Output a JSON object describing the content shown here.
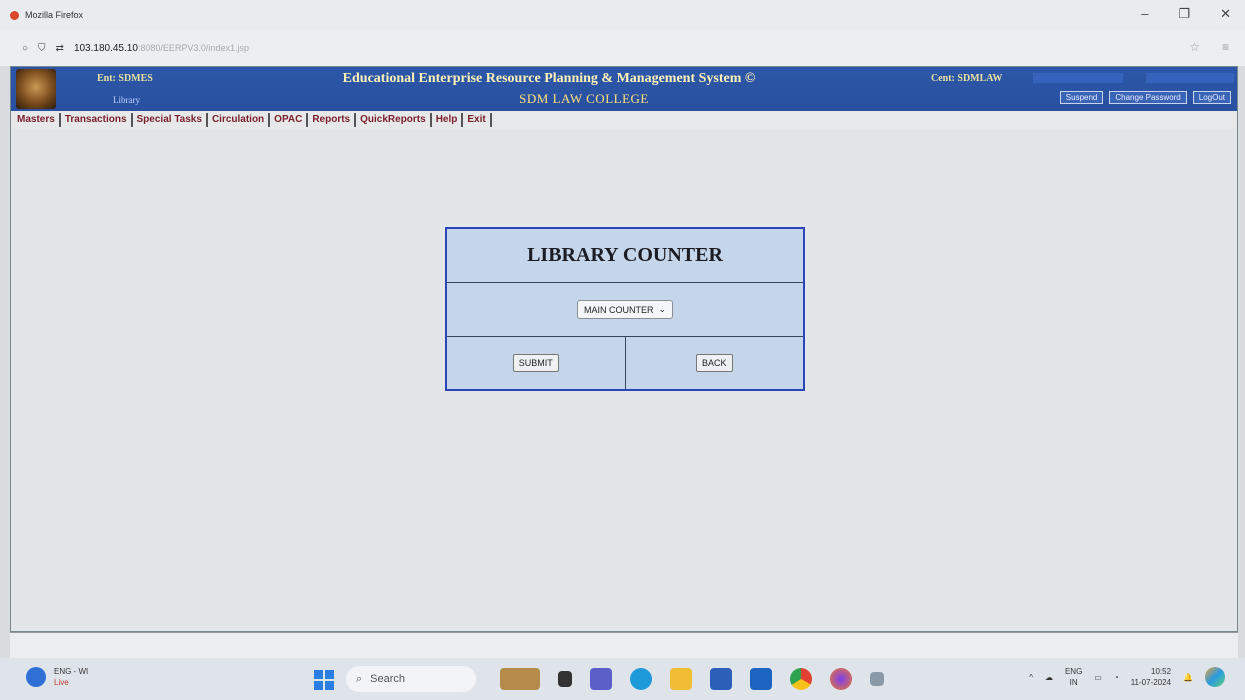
{
  "browser": {
    "title": "Mozilla Firefox",
    "url_host": "103.180.45.10",
    "url_rest": ":8080/EERPV3.0/index1.jsp"
  },
  "header": {
    "ent_label": "Ent: SDMES",
    "ent_sub": "Library",
    "system_title": "Educational Enterprise Resource Planning & Management System ©",
    "college_name": "SDM LAW COLLEGE",
    "center_label": "Cent: SDMLAW",
    "buttons": [
      "Suspend",
      "Change Password",
      "LogOut"
    ]
  },
  "menu": [
    "Masters",
    "Transactions",
    "Special Tasks",
    "Circulation",
    "OPAC",
    "Reports",
    "QuickReports",
    "Help",
    "Exit"
  ],
  "dialog": {
    "title": "LIBRARY COUNTER",
    "select_value": "MAIN COUNTER",
    "submit_label": "SUBMIT",
    "back_label": "BACK"
  },
  "taskbar": {
    "weather_lang": "ENG - WI",
    "weather_live": "Live",
    "search_placeholder": "Search",
    "lang_top": "ENG",
    "lang_bottom": "IN",
    "time": "10:52",
    "date": "11-07-2024"
  },
  "colors": {
    "banner": "#2c57a8",
    "menu_text": "#7a1f2a",
    "dialog_bg": "#c6d6ea",
    "dialog_border": "#2b45b8"
  }
}
